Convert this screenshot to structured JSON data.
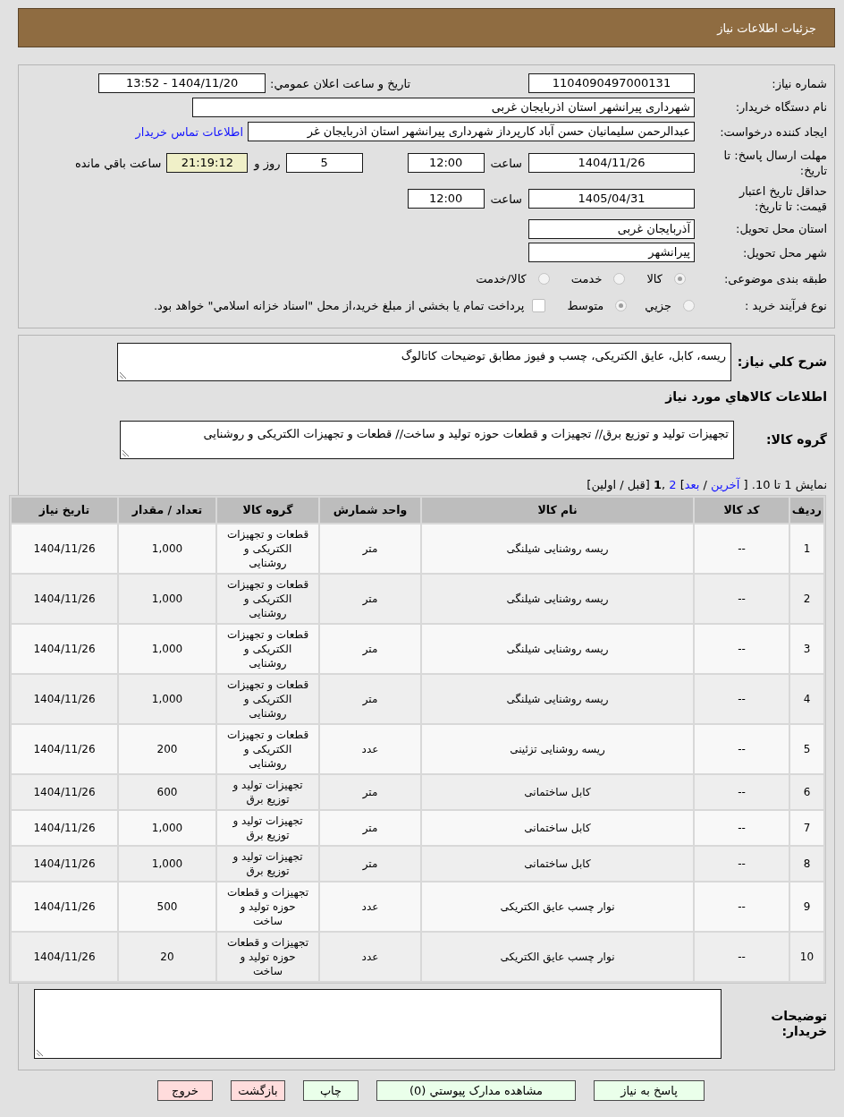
{
  "header": {
    "title": "جزئيات اطلاعات نياز"
  },
  "details": {
    "need_number": {
      "label": "شماره نياز:",
      "value": "1104090497000131"
    },
    "announcement": {
      "label": "تاريخ و ساعت اعلان عمومي:",
      "value": "1404/11/20 - 13:52"
    },
    "buyer_org": {
      "label": "نام دستگاه خريدار:",
      "value": "شهرداری پیرانشهر استان اذربایجان غربی"
    },
    "requester": {
      "label": "ايجاد کننده درخواست:",
      "value": "عبدالرحمن سلیمانیان حسن آباد کارپرداز شهرداری پیرانشهر استان اذربایجان غر",
      "link": "اطلاعات تماس خريدار"
    },
    "reply_deadline": {
      "label": "مهلت ارسال پاسخ: تا تاريخ:",
      "date": "1404/11/26",
      "time_label": "ساعت",
      "time": "12:00",
      "days": "5",
      "days_label": "روز و",
      "remaining": "21:19:12",
      "remaining_label": "ساعت باقي مانده"
    },
    "price_validity": {
      "label": "حداقل تاريخ اعتبار قيمت: تا تاريخ:",
      "date": "1405/04/31",
      "time_label": "ساعت",
      "time": "12:00"
    },
    "delivery_province": {
      "label": "استان محل تحويل:",
      "value": "آذربایجان غربی"
    },
    "delivery_city": {
      "label": "شهر محل تحويل:",
      "value": "پیرانشهر"
    },
    "category": {
      "label": "طبقه بندی موضوعی:",
      "options": [
        {
          "label": "کالا",
          "selected": true
        },
        {
          "label": "خدمت",
          "selected": false
        },
        {
          "label": "کالا/خدمت",
          "selected": false
        }
      ]
    },
    "process": {
      "label": "نوع فرآيند خريد :",
      "options": [
        {
          "label": "جزيي",
          "selected": false
        },
        {
          "label": "متوسط",
          "selected": true
        }
      ],
      "treasury": {
        "label": "پرداخت تمام يا بخشي از مبلغ خريد،از محل \"اسناد خزانه اسلامي\" خواهد بود.",
        "checked": false
      }
    }
  },
  "need_description": {
    "label": "شرح کلي نياز:",
    "value": "ریسه، کابل، عایق الکتریکی، چسب و فیوز مطابق توضیحات کاتالوگ"
  },
  "items_heading": "اطلاعات کالاهاي مورد نياز",
  "goods_group": {
    "label": "گروه کالا:",
    "value": "تجهیزات تولید و توزیع برق// تجهیزات و قطعات حوزه تولید و ساخت// قطعات و تجهیزات الکتریکی و روشنایی"
  },
  "pagination": [
    {
      "kind": "text",
      "text": "نمايش 1 تا 10. [ "
    },
    {
      "kind": "link",
      "text": "آخرين"
    },
    {
      "kind": "text",
      "text": " / "
    },
    {
      "kind": "link",
      "text": "بعد"
    },
    {
      "kind": "text",
      "text": "] "
    },
    {
      "kind": "link",
      "text": "2"
    },
    {
      "kind": "text",
      "text": " ,"
    },
    {
      "kind": "current",
      "text": "1"
    },
    {
      "kind": "text",
      "text": " [قبل / اولين]"
    }
  ],
  "table": {
    "columns": [
      "رديف",
      "کد کالا",
      "نام کالا",
      "واحد شمارش",
      "گروه کالا",
      "تعداد / مقدار",
      "تاريخ نياز"
    ],
    "rows": [
      [
        "1",
        "--",
        "ریسه روشنایی شیلنگی",
        "متر",
        "قطعات و تجهیزات الکتریکی و روشنایی",
        "1,000",
        "1404/11/26"
      ],
      [
        "2",
        "--",
        "ریسه روشنایی شیلنگی",
        "متر",
        "قطعات و تجهیزات الکتریکی و روشنایی",
        "1,000",
        "1404/11/26"
      ],
      [
        "3",
        "--",
        "ریسه روشنایی شیلنگی",
        "متر",
        "قطعات و تجهیزات الکتریکی و روشنایی",
        "1,000",
        "1404/11/26"
      ],
      [
        "4",
        "--",
        "ریسه روشنایی شیلنگی",
        "متر",
        "قطعات و تجهیزات الکتریکی و روشنایی",
        "1,000",
        "1404/11/26"
      ],
      [
        "5",
        "--",
        "ریسه روشنایی تزئینی",
        "عدد",
        "قطعات و تجهیزات الکتریکی و روشنایی",
        "200",
        "1404/11/26"
      ],
      [
        "6",
        "--",
        "کابل ساختمانی",
        "متر",
        "تجهیزات تولید و توزیع برق",
        "600",
        "1404/11/26"
      ],
      [
        "7",
        "--",
        "کابل ساختمانی",
        "متر",
        "تجهیزات تولید و توزیع برق",
        "1,000",
        "1404/11/26"
      ],
      [
        "8",
        "--",
        "کابل ساختمانی",
        "متر",
        "تجهیزات تولید و توزیع برق",
        "1,000",
        "1404/11/26"
      ],
      [
        "9",
        "--",
        "نوار چسب عایق الکتریکی",
        "عدد",
        "تجهیزات و قطعات حوزه تولید و ساخت",
        "500",
        "1404/11/26"
      ],
      [
        "10",
        "--",
        "نوار چسب عایق الکتریکی",
        "عدد",
        "تجهیزات و قطعات حوزه تولید و ساخت",
        "20",
        "1404/11/26"
      ]
    ]
  },
  "buyer_notes": {
    "label": "توضيحات خريدار:"
  },
  "buttons": [
    {
      "label": "پاسخ به نياز",
      "kind": "action"
    },
    {
      "label": "مشاهده مدارک پيوستي (0)",
      "kind": "action"
    },
    {
      "label": "چاپ",
      "kind": "action"
    },
    {
      "label": "بازگشت",
      "kind": "exit"
    },
    {
      "label": "خروج",
      "kind": "exit"
    }
  ]
}
